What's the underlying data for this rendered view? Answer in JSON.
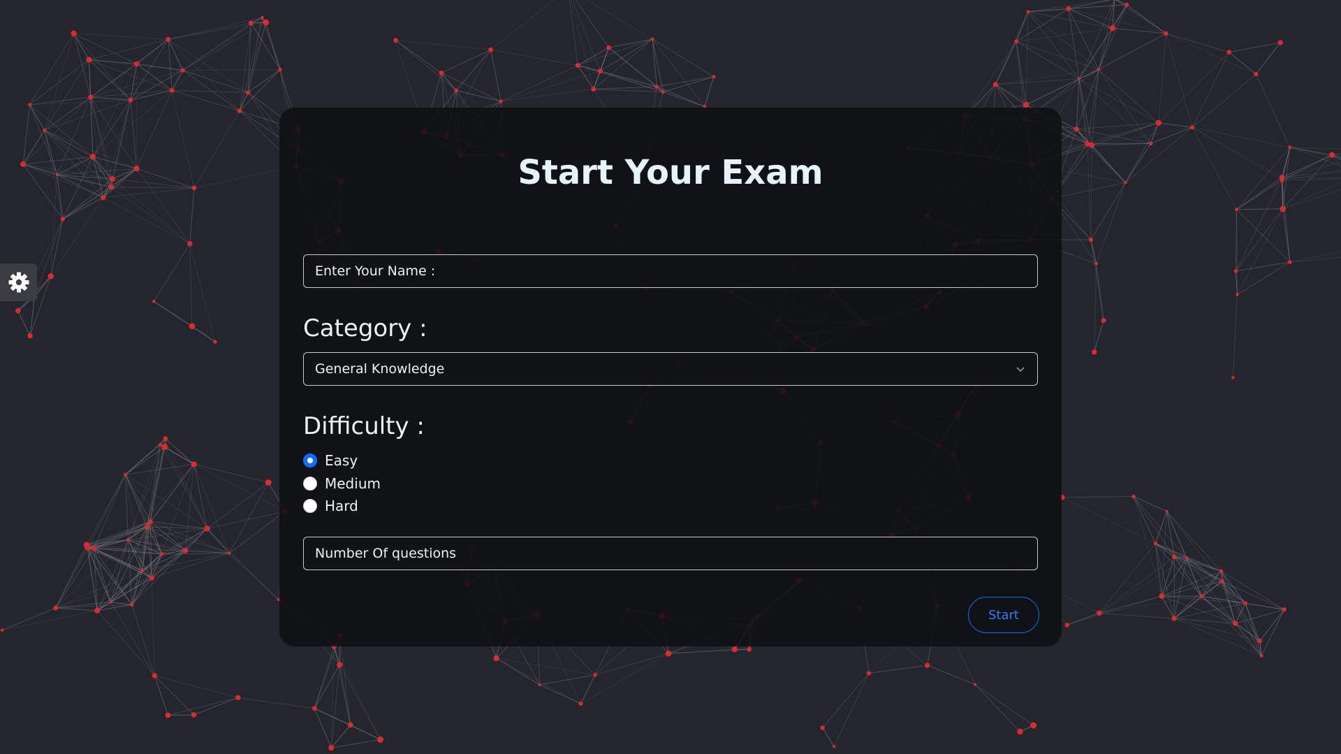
{
  "page": {
    "title": "Start Your Exam"
  },
  "name_input": {
    "placeholder": "Enter Your Name :",
    "value": ""
  },
  "category": {
    "label": "Category :",
    "selected": "General Knowledge"
  },
  "difficulty": {
    "label": "Difficulty :",
    "options": [
      {
        "label": "Easy",
        "checked": true
      },
      {
        "label": "Medium",
        "checked": false
      },
      {
        "label": "Hard",
        "checked": false
      }
    ]
  },
  "questions_input": {
    "placeholder": "Number Of questions",
    "value": ""
  },
  "start_button": {
    "label": "Start"
  },
  "icons": {
    "settings": "gear-icon",
    "select_caret": "chevron-down-icon"
  },
  "colors": {
    "background": "#23262c",
    "card": "#0e0f11",
    "accent": "#0d6efd",
    "network_node": "#e0282e",
    "network_line": "#8a8d93",
    "title_text": "#e6f4fa"
  }
}
